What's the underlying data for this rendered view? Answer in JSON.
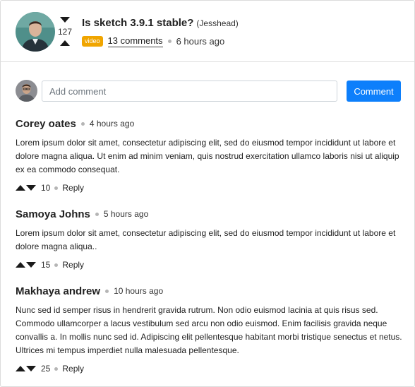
{
  "post": {
    "title": "Is sketch 3.9.1 stable?",
    "author": "(Jesshead)",
    "score": "127",
    "tag": "video",
    "comments_link": "13 comments",
    "time": "6 hours ago",
    "colors": {
      "tag": "#f0a500"
    }
  },
  "composer": {
    "placeholder": "Add comment",
    "button_label": "Comment",
    "colors": {
      "button": "#0d7ffb"
    }
  },
  "comments": [
    {
      "name": "Corey oates",
      "time": "4 hours ago",
      "body": "Lorem ipsum dolor sit amet, consectetur adipiscing elit, sed do eiusmod tempor incididunt ut labore et dolore magna aliqua. Ut enim ad minim veniam, quis nostrud exercitation ullamco laboris nisi ut aliquip ex ea commodo consequat.",
      "score": "10",
      "reply_label": "Reply"
    },
    {
      "name": "Samoya Johns",
      "time": "5 hours ago",
      "body": "Lorem ipsum dolor sit amet, consectetur adipiscing elit, sed do eiusmod tempor incididunt ut labore et dolore magna aliqua..",
      "score": "15",
      "reply_label": "Reply"
    },
    {
      "name": "Makhaya andrew",
      "time": "10 hours ago",
      "body": "Nunc sed id semper risus in hendrerit gravida rutrum. Non odio euismod lacinia at quis risus sed. Commodo ullamcorper a lacus vestibulum sed arcu non odio euismod. Enim facilisis gravida neque convallis a. In mollis nunc sed id. Adipiscing elit pellentesque habitant morbi tristique senectus et netus. Ultrices mi tempus imperdiet nulla malesuada pellentesque.",
      "score": "25",
      "reply_label": "Reply"
    }
  ]
}
